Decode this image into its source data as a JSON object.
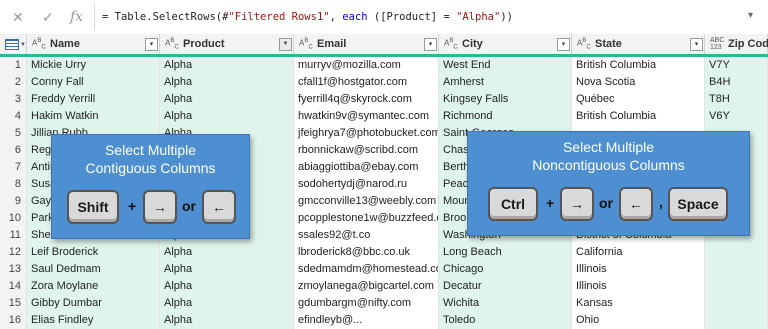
{
  "formula_bar": {
    "cancel_icon": "x-icon",
    "accept_icon": "check-icon",
    "fx_label": "fx",
    "expand_icon": "chevron-down-icon",
    "formula_prefix": "= Table.SelectRows(#",
    "formula_string1": "\"Filtered Rows1\"",
    "formula_mid": ", ",
    "formula_keyword": "each",
    "formula_mid2": " ([Product] = ",
    "formula_string2": "\"Alpha\"",
    "formula_suffix": "))"
  },
  "columns": [
    {
      "type": "ABC",
      "label": "Name",
      "filtered": false
    },
    {
      "type": "ABC",
      "label": "Product",
      "filtered": true
    },
    {
      "type": "ABC",
      "label": "Email",
      "filtered": false
    },
    {
      "type": "ABC",
      "label": "City",
      "filtered": false
    },
    {
      "type": "ABC",
      "label": "State",
      "filtered": false
    },
    {
      "type": "ABC 123",
      "label": "Zip Code",
      "filtered": false
    }
  ],
  "rows": [
    {
      "n": "1",
      "name": "Mickie Urry",
      "product": "Alpha",
      "email": "murryv@mozilla.com",
      "city": "West End",
      "state": "British Columbia",
      "zip": "V7Y"
    },
    {
      "n": "2",
      "name": "Conny Fall",
      "product": "Alpha",
      "email": "cfall1f@hostgator.com",
      "city": "Amherst",
      "state": "Nova Scotia",
      "zip": "B4H"
    },
    {
      "n": "3",
      "name": "Freddy Yerrill",
      "product": "Alpha",
      "email": "fyerrill4q@skyrock.com",
      "city": "Kingsey Falls",
      "state": "Québec",
      "zip": "T8H"
    },
    {
      "n": "4",
      "name": "Hakim Watkin",
      "product": "Alpha",
      "email": "hwatkin9v@symantec.com",
      "city": "Richmond",
      "state": "British Columbia",
      "zip": "V6Y"
    },
    {
      "n": "5",
      "name": "Jillian Rubb",
      "product": "Alpha",
      "email": "jfeighrya7@photobucket.com",
      "city": "Saint-Georges",
      "state": "",
      "zip": ""
    },
    {
      "n": "6",
      "name": "Reggie",
      "product": "",
      "email": "rbonnickaw@scribd.com",
      "city": "Chase",
      "state": "",
      "zip": ""
    },
    {
      "n": "7",
      "name": "Antin",
      "product": "",
      "email": "abiaggiottiba@ebay.com",
      "city": "Berthier",
      "state": "",
      "zip": ""
    },
    {
      "n": "8",
      "name": "Susan",
      "product": "",
      "email": "sodohertydj@narod.ru",
      "city": "Peachland",
      "state": "",
      "zip": ""
    },
    {
      "n": "9",
      "name": "Gayle",
      "product": "",
      "email": "gmcconville13@weebly.com",
      "city": "Mount",
      "state": "",
      "zip": ""
    },
    {
      "n": "10",
      "name": "Park",
      "product": "",
      "email": "pcopplestone1w@buzzfeed.com",
      "city": "Brooklyn",
      "state": "",
      "zip": ""
    },
    {
      "n": "11",
      "name": "Shelton Sales",
      "product": "Alpha",
      "email": "ssales92@t.co",
      "city": "Washington",
      "state": "District of Columbia",
      "zip": ""
    },
    {
      "n": "12",
      "name": "Leif Broderick",
      "product": "Alpha",
      "email": "lbroderick8@bbc.co.uk",
      "city": "Long Beach",
      "state": "California",
      "zip": ""
    },
    {
      "n": "13",
      "name": "Saul Dedmam",
      "product": "Alpha",
      "email": "sdedmamdm@homestead.com",
      "city": "Chicago",
      "state": "Illinois",
      "zip": ""
    },
    {
      "n": "14",
      "name": "Zora Moylane",
      "product": "Alpha",
      "email": "zmoylanega@bigcartel.com",
      "city": "Decatur",
      "state": "Illinois",
      "zip": ""
    },
    {
      "n": "15",
      "name": "Gibby Dumbar",
      "product": "Alpha",
      "email": "gdumbargm@nifty.com",
      "city": "Wichita",
      "state": "Kansas",
      "zip": ""
    },
    {
      "n": "16",
      "name": "Elias Findley",
      "product": "Alpha",
      "email": "efindleyb@...",
      "city": "Toledo",
      "state": "Ohio",
      "zip": ""
    }
  ],
  "callout_contiguous": {
    "title_line1": "Select Multiple",
    "title_line2": "Contiguous Columns",
    "key1": "Shift",
    "plus": "+",
    "right_arrow": "→",
    "or": "or",
    "left_arrow": "←"
  },
  "callout_noncontiguous": {
    "title_line1": "Select Multiple",
    "title_line2": "Noncontiguous Columns",
    "key1": "Ctrl",
    "plus": "+",
    "right_arrow": "→",
    "or": "or",
    "left_arrow": "←",
    "comma": ",",
    "key_space": "Space"
  },
  "colors": {
    "accent_teal": "#2db792",
    "selected_column_bg": "#dff4ec",
    "callout_blue": "#4e8fd1"
  }
}
